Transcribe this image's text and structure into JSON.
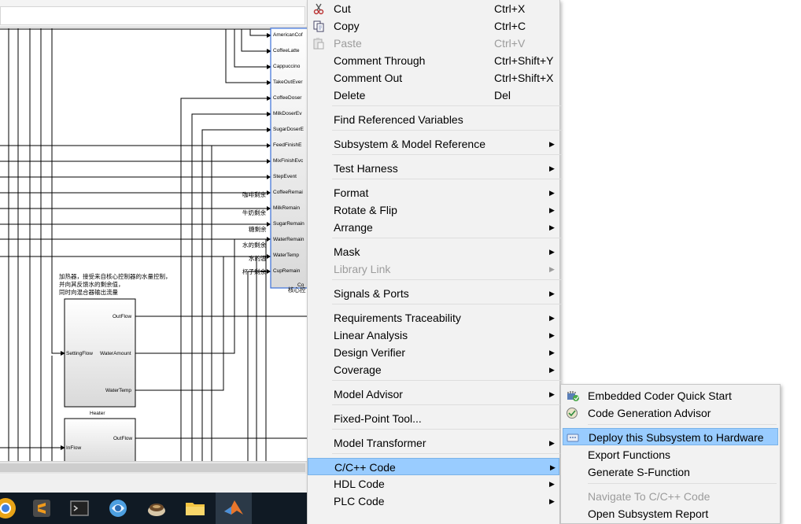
{
  "canvas": {
    "output_ports": [
      "AmericanCof",
      "CoffeeLatte",
      "Cappuccino",
      "TakeOutEver",
      "CoffeeDoser",
      "MilkDoserEv",
      "SugarDoserE",
      "FeedFinishE",
      "MixFinishEvc",
      "StepEvent",
      "CoffeeRemai",
      "MilkRemain",
      "SugarRemain",
      "WaterRemain",
      "WaterTemp",
      "CupRemain"
    ],
    "signal_labels": [
      "咖啡剩余",
      "牛奶剩余",
      "糖剩余",
      "水的剩余",
      "水的温",
      "杯子剩余"
    ],
    "core_block_label": "核心控",
    "core_block_partial": "Co",
    "heater_comment": [
      "加热器，接受来自核心控制器的水量控制，",
      "并向其反馈水的剩余值，",
      "同时向混合器输出流量"
    ],
    "heater": {
      "name": "Heater",
      "inputs": [
        "SettingFlow"
      ],
      "outputs": [
        "OutFlow",
        "WaterAmount",
        "WaterTemp"
      ]
    },
    "block2": {
      "inputs": [
        "InFlow"
      ],
      "outputs": [
        "OutFlow"
      ]
    }
  },
  "taskbar": {
    "icons": [
      "chrome-icon",
      "sublime-text-icon",
      "terminal-icon",
      "browser-icon",
      "coffee-icon",
      "file-explorer-icon",
      "matlab-icon"
    ]
  },
  "context_menu": {
    "items": [
      {
        "label": "Cut",
        "shortcut": "Ctrl+X",
        "icon": "scissors-icon"
      },
      {
        "label": "Copy",
        "shortcut": "Ctrl+C",
        "icon": "copy-icon"
      },
      {
        "label": "Paste",
        "shortcut": "Ctrl+V",
        "icon": "paste-icon",
        "disabled": true
      },
      {
        "label": "Comment Through",
        "shortcut": "Ctrl+Shift+Y"
      },
      {
        "label": "Comment Out",
        "shortcut": "Ctrl+Shift+X"
      },
      {
        "label": "Delete",
        "shortcut": "Del"
      },
      {
        "label": "Find Referenced Variables"
      },
      {
        "label": "Subsystem & Model Reference",
        "submenu": true
      },
      {
        "label": "Test Harness",
        "submenu": true
      },
      {
        "label": "Format",
        "submenu": true
      },
      {
        "label": "Rotate & Flip",
        "submenu": true
      },
      {
        "label": "Arrange",
        "submenu": true
      },
      {
        "label": "Mask",
        "submenu": true
      },
      {
        "label": "Library Link",
        "submenu": true,
        "disabled": true
      },
      {
        "label": "Signals & Ports",
        "submenu": true
      },
      {
        "label": "Requirements Traceability",
        "submenu": true
      },
      {
        "label": "Linear Analysis",
        "submenu": true
      },
      {
        "label": "Design Verifier",
        "submenu": true
      },
      {
        "label": "Coverage",
        "submenu": true
      },
      {
        "label": "Model Advisor",
        "submenu": true
      },
      {
        "label": "Fixed-Point Tool..."
      },
      {
        "label": "Model Transformer",
        "submenu": true
      },
      {
        "label": "C/C++ Code",
        "submenu": true,
        "highlighted": true
      },
      {
        "label": "HDL Code",
        "submenu": true
      },
      {
        "label": "PLC Code",
        "submenu": true
      }
    ]
  },
  "cpp_submenu": {
    "items": [
      {
        "label": "Embedded Coder Quick Start",
        "icon": "embedded-coder-icon"
      },
      {
        "label": "Code Generation Advisor",
        "icon": "code-advisor-icon"
      },
      {
        "label": "Deploy this Subsystem to Hardware",
        "icon": "deploy-hardware-icon",
        "highlighted": true
      },
      {
        "label": "Export Functions"
      },
      {
        "label": "Generate S-Function"
      },
      {
        "label": "Navigate To C/C++ Code",
        "disabled": true
      },
      {
        "label": "Open Subsystem Report"
      }
    ]
  },
  "colors": {
    "menu_bg": "#f2f2f2",
    "highlight": "#99ccff",
    "disabled_text": "#9c9c9c",
    "taskbar": "#101a24",
    "block_port": "#3a6fd8"
  }
}
